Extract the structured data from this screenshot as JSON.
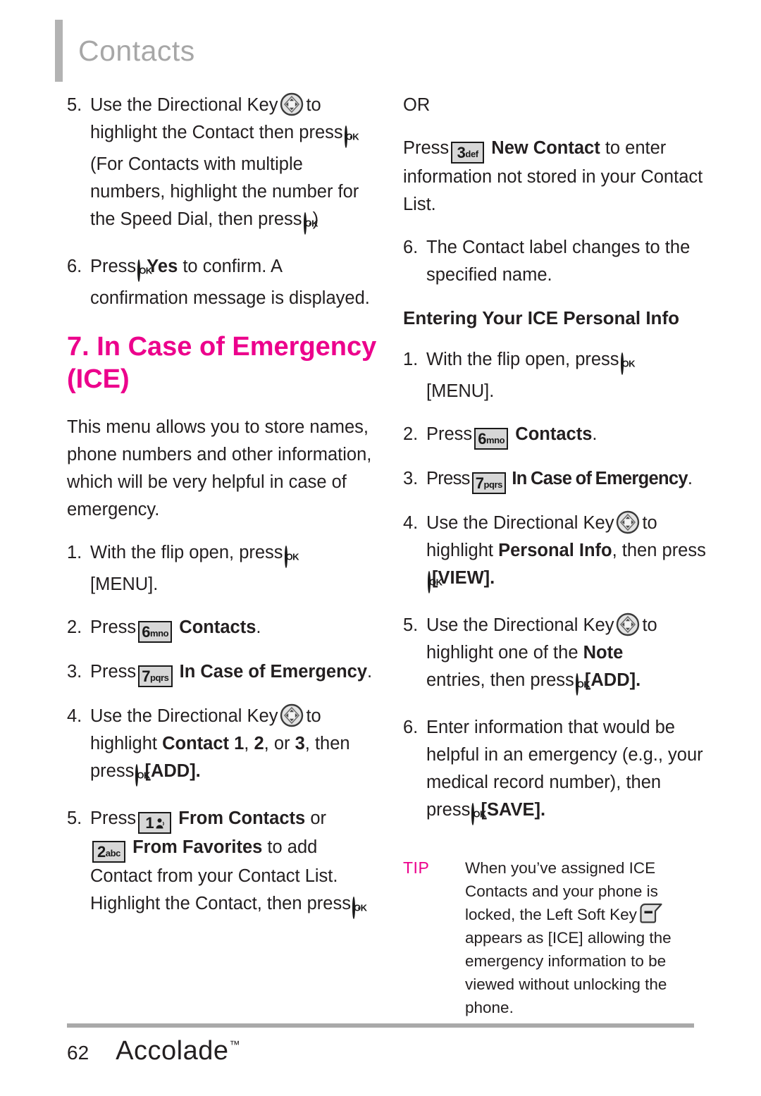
{
  "header": {
    "title": "Contacts"
  },
  "icons": {
    "ok_key": "ok-key-icon",
    "directional_key": "directional-key-icon",
    "left_soft_key": "left-soft-key-icon",
    "key_1": {
      "digit": "1",
      "letters": "",
      "glyph": "voicemail"
    },
    "key_2": {
      "digit": "2",
      "letters": "abc"
    },
    "key_3": {
      "digit": "3",
      "letters": "def"
    },
    "key_6": {
      "digit": "6",
      "letters": "mno"
    },
    "key_7": {
      "digit": "7",
      "letters": "pqrs"
    }
  },
  "colors": {
    "accent": "#EC008C",
    "header_gray": "#a7a7a7",
    "body_text": "#231f20"
  },
  "left_column": {
    "step5": {
      "num": "5.",
      "part1": "Use the Directional Key",
      "part2": "to highlight the Contact then press",
      "part3": ". (For Contacts with multiple numbers, highlight the number for the Speed Dial, then press",
      "part4": ".)"
    },
    "step6": {
      "num": "6.",
      "part1": "Press",
      "bold1": "Yes",
      "part2": "to confirm. A confirmation message is displayed."
    },
    "section_heading": "7. In Case of Emergency (ICE)",
    "intro": "This menu allows you to store names, phone numbers and other information, which will be very helpful in case of emergency.",
    "step1": {
      "num": "1.",
      "part1": "With the flip open, press",
      "part2": "[MENU]."
    },
    "step2": {
      "num": "2.",
      "part1": "Press",
      "bold1": "Contacts",
      "part2": "."
    },
    "step3": {
      "num": "3.",
      "part1": "Press",
      "bold1": "In Case of Emergency",
      "part2": "."
    },
    "step4": {
      "num": "4.",
      "part1": "Use the Directional Key",
      "part2": "to highlight",
      "bold1": "Contact 1",
      "sep1": ",",
      "bold2": "2",
      "sep2": ", or",
      "bold3": "3",
      "part3": ", then press",
      "part4": "[ADD]."
    },
    "step5b": {
      "num": "5.",
      "part1": "Press",
      "bold1": "From Contacts",
      "part2": "or",
      "bold2": "From Favorites",
      "part3": "to add Contact from your Contact List. Highlight the Contact, then press",
      "part4": "."
    }
  },
  "right_column": {
    "or_label": "OR",
    "or_body": {
      "part1": "Press",
      "bold1": "New Contact",
      "part2": "to enter information not stored in your Contact List."
    },
    "step6": {
      "num": "6.",
      "text": "The Contact label changes to the specified name."
    },
    "sub_heading": "Entering Your ICE Personal Info",
    "step1": {
      "num": "1.",
      "part1": "With the flip open, press",
      "part2": "[MENU]."
    },
    "step2": {
      "num": "2.",
      "part1": "Press",
      "bold1": "Contacts",
      "part2": "."
    },
    "step3": {
      "num": "3.",
      "part1": "Press",
      "bold1": "In Case of Emergency",
      "part2": "."
    },
    "step4": {
      "num": "4.",
      "part1": "Use the Directional Key",
      "part2": "to highlight",
      "bold1": "Personal Info",
      "part3": ", then press",
      "part4": "[VIEW]."
    },
    "step5": {
      "num": "5.",
      "part1": "Use the Directional Key",
      "part2": "to highlight one of the",
      "bold1": "Note",
      "part3": "entries, then press",
      "part4": "[ADD]."
    },
    "step6b": {
      "num": "6.",
      "part1": "Enter information that would be helpful in an emergency (e.g., your medical record number), then press",
      "part2": "[SAVE]."
    },
    "tip": {
      "label": "TIP",
      "part1": "When you’ve assigned ICE Contacts and your phone is locked, the Left Soft Key",
      "part2": "appears as [ICE] allowing the emergency information to be viewed without unlocking the phone."
    }
  },
  "footer": {
    "page_number": "62",
    "brand": "Accolade",
    "trademark": "™"
  }
}
